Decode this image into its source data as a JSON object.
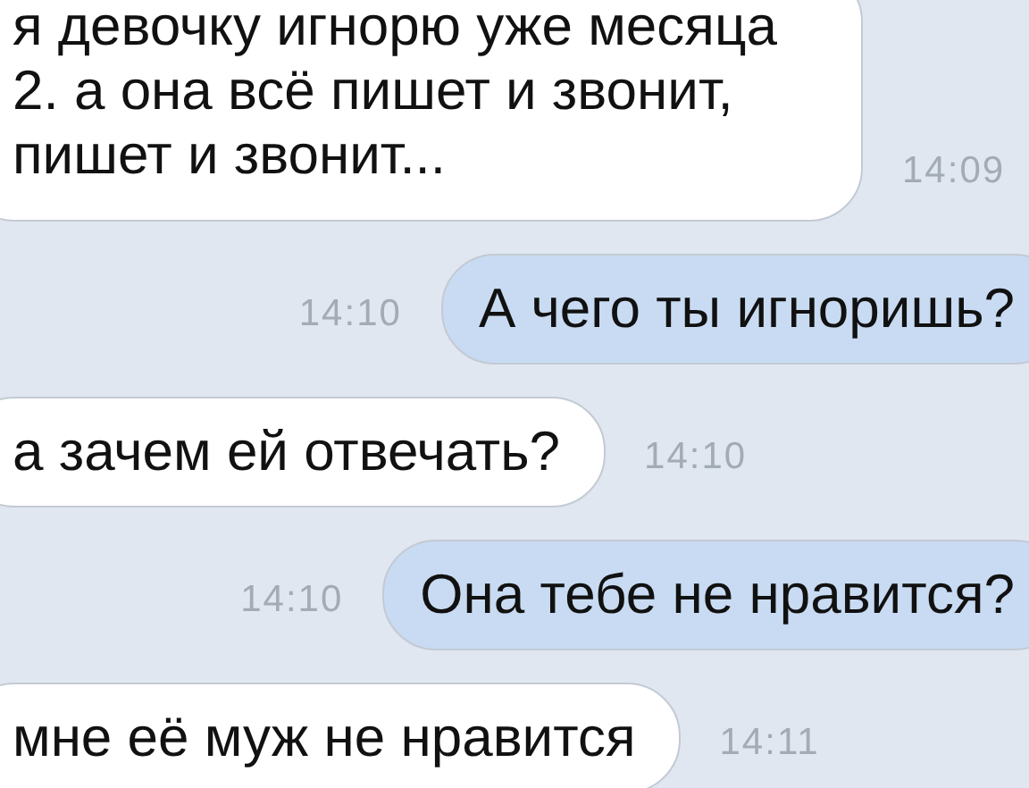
{
  "messages": [
    {
      "kind": "incoming",
      "text": "я девочку игнорю уже месяца 2. а она всё пишет и звонит, пишет и звонит...",
      "time": "14:09"
    },
    {
      "kind": "outgoing",
      "text": "А чего ты игноришь?",
      "time": "14:10"
    },
    {
      "kind": "incoming",
      "text": "а зачем ей отвечать?",
      "time": "14:10"
    },
    {
      "kind": "outgoing",
      "text": "Она тебе не нравится?",
      "time": "14:10"
    },
    {
      "kind": "incoming",
      "text": "мне её муж не нравится",
      "time": "14:11"
    }
  ]
}
